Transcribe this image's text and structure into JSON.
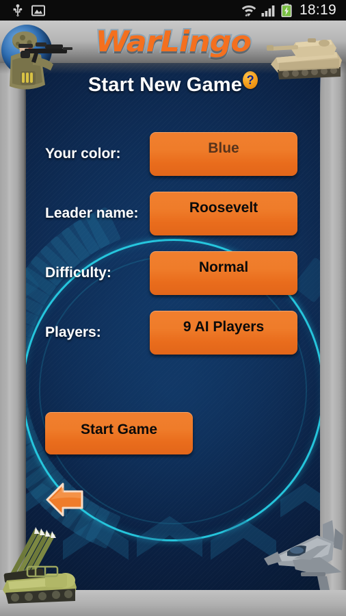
{
  "status_bar": {
    "time": "18:19",
    "icons": [
      "usb-icon",
      "gallery-image-icon",
      "wifi-icon",
      "cellular-signal-icon",
      "battery-charging-icon"
    ]
  },
  "header": {
    "logo_text": "WarLingo",
    "left_art": "soldier-with-rifle-over-globe",
    "right_art": "battle-tank"
  },
  "title": {
    "text": "Start New Game",
    "help_badge": "?"
  },
  "form": {
    "rows": [
      {
        "label": "Your color:",
        "value": "Blue",
        "name": "color"
      },
      {
        "label": "Leader name:",
        "value": "Roosevelt",
        "name": "leader-name"
      },
      {
        "label": "Difficulty:",
        "value": "Normal",
        "name": "difficulty"
      },
      {
        "label": "Players:",
        "value": "9 AI Players",
        "name": "players"
      }
    ]
  },
  "actions": {
    "start_game": "Start Game",
    "back": "back-arrow"
  },
  "footer": {
    "left_art": "missile-launcher-vehicle",
    "right_art": "fighter-jet-firing-missile"
  },
  "colors": {
    "accent_orange": "#ef7c2a",
    "background_navy": "#0e2c55",
    "cyan_ring": "#28d2e8",
    "frame_gray": "#b5b5b5",
    "help_badge_orange": "#f5a01d",
    "help_badge_text": "#10228c"
  }
}
